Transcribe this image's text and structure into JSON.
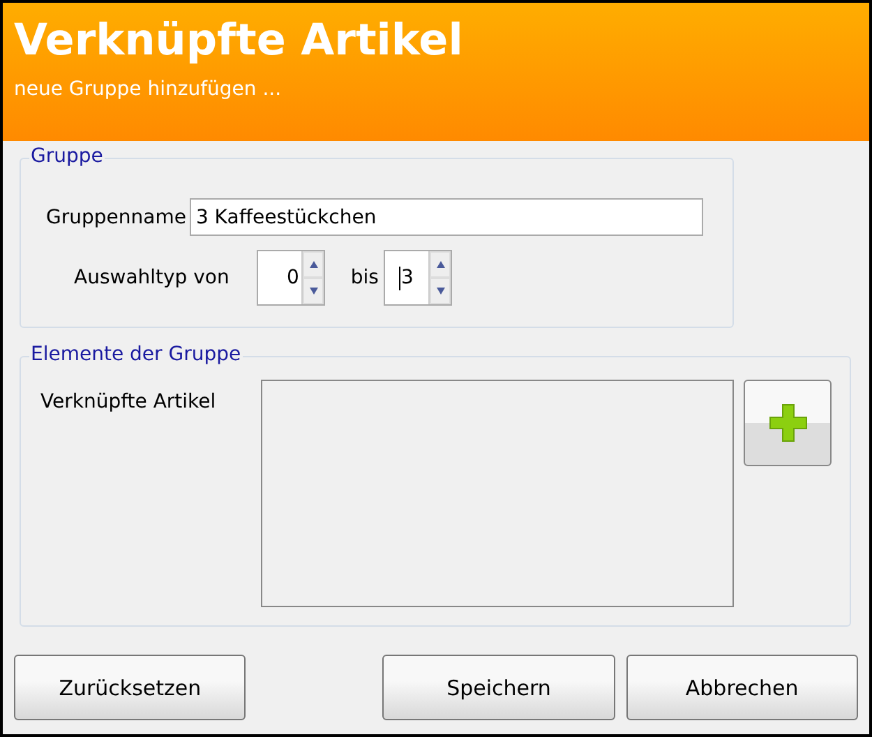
{
  "header": {
    "title": "Verknüpfte Artikel",
    "subtitle": "neue Gruppe hinzufügen ..."
  },
  "group": {
    "legend": "Gruppe",
    "name_label": "Gruppenname",
    "name_value": "3 Kaffeestückchen",
    "range_label": "Auswahltyp von",
    "from_value": "0",
    "to_label": "bis",
    "to_value": "3"
  },
  "elements": {
    "legend": "Elemente der Gruppe",
    "list_label": "Verknüpfte Artikel"
  },
  "buttons": [
    "Zurücksetzen",
    "Speichern",
    "Abbrechen"
  ]
}
